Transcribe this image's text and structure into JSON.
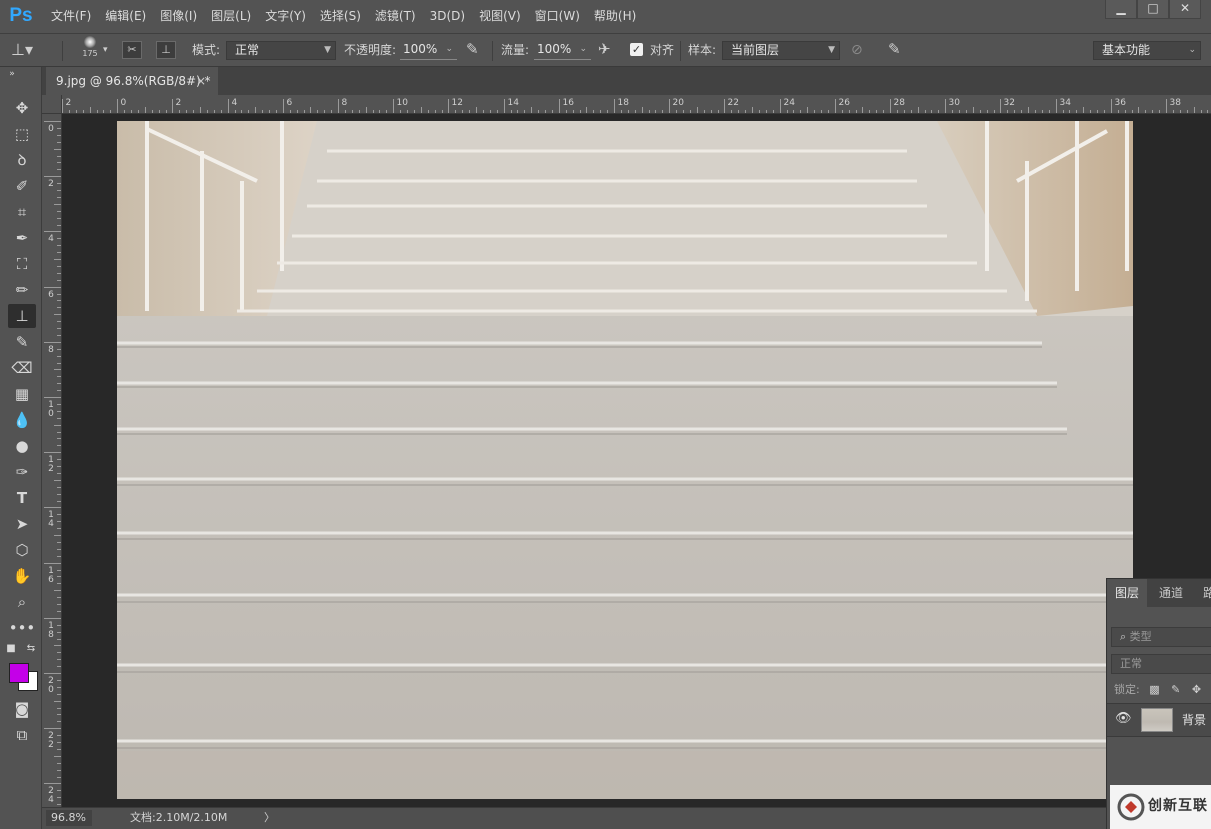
{
  "app": {
    "logo": "Ps"
  },
  "menu": [
    {
      "label": "文件(F)"
    },
    {
      "label": "编辑(E)"
    },
    {
      "label": "图像(I)"
    },
    {
      "label": "图层(L)"
    },
    {
      "label": "文字(Y)"
    },
    {
      "label": "选择(S)"
    },
    {
      "label": "滤镜(T)"
    },
    {
      "label": "3D(D)"
    },
    {
      "label": "视图(V)"
    },
    {
      "label": "窗口(W)"
    },
    {
      "label": "帮助(H)"
    }
  ],
  "window_controls": {
    "minimize": "▁",
    "maximize": "□",
    "close": "✕"
  },
  "options": {
    "brush_size": "175",
    "mode_label": "模式:",
    "mode_value": "正常",
    "opacity_label": "不透明度:",
    "opacity_value": "100%",
    "flow_label": "流量:",
    "flow_value": "100%",
    "aligned_label": "对齐",
    "aligned_checked": true,
    "sample_label": "样本:",
    "sample_value": "当前图层",
    "workspace_value": "基本功能"
  },
  "document_tab": {
    "title": "9.jpg @ 96.8%(RGB/8#) *",
    "close": "×"
  },
  "ruler": {
    "top_labels": [
      "2",
      "0",
      "2",
      "4",
      "6",
      "8",
      "10",
      "12",
      "14",
      "16",
      "18",
      "20",
      "22",
      "24",
      "26",
      "28",
      "30",
      "32",
      "34",
      "36",
      "38"
    ],
    "left_labels": [
      "0",
      "2",
      "4",
      "6",
      "8",
      "10",
      "12",
      "14",
      "16",
      "18",
      "20",
      "22",
      "24"
    ]
  },
  "colors": {
    "foreground": "#c400e8",
    "background": "#ffffff",
    "accent": "#31a8ff"
  },
  "status": {
    "zoom": "96.8%",
    "doc_info": "文档:2.10M/2.10M",
    "arrow": "〉"
  },
  "layers_panel": {
    "tabs": [
      "图层",
      "通道",
      "路"
    ],
    "kind_placeholder": "类型",
    "blend_mode": "正常",
    "lock_label": "锁定:",
    "layer_name": "背景"
  },
  "watermark": {
    "text": "创新互联"
  }
}
